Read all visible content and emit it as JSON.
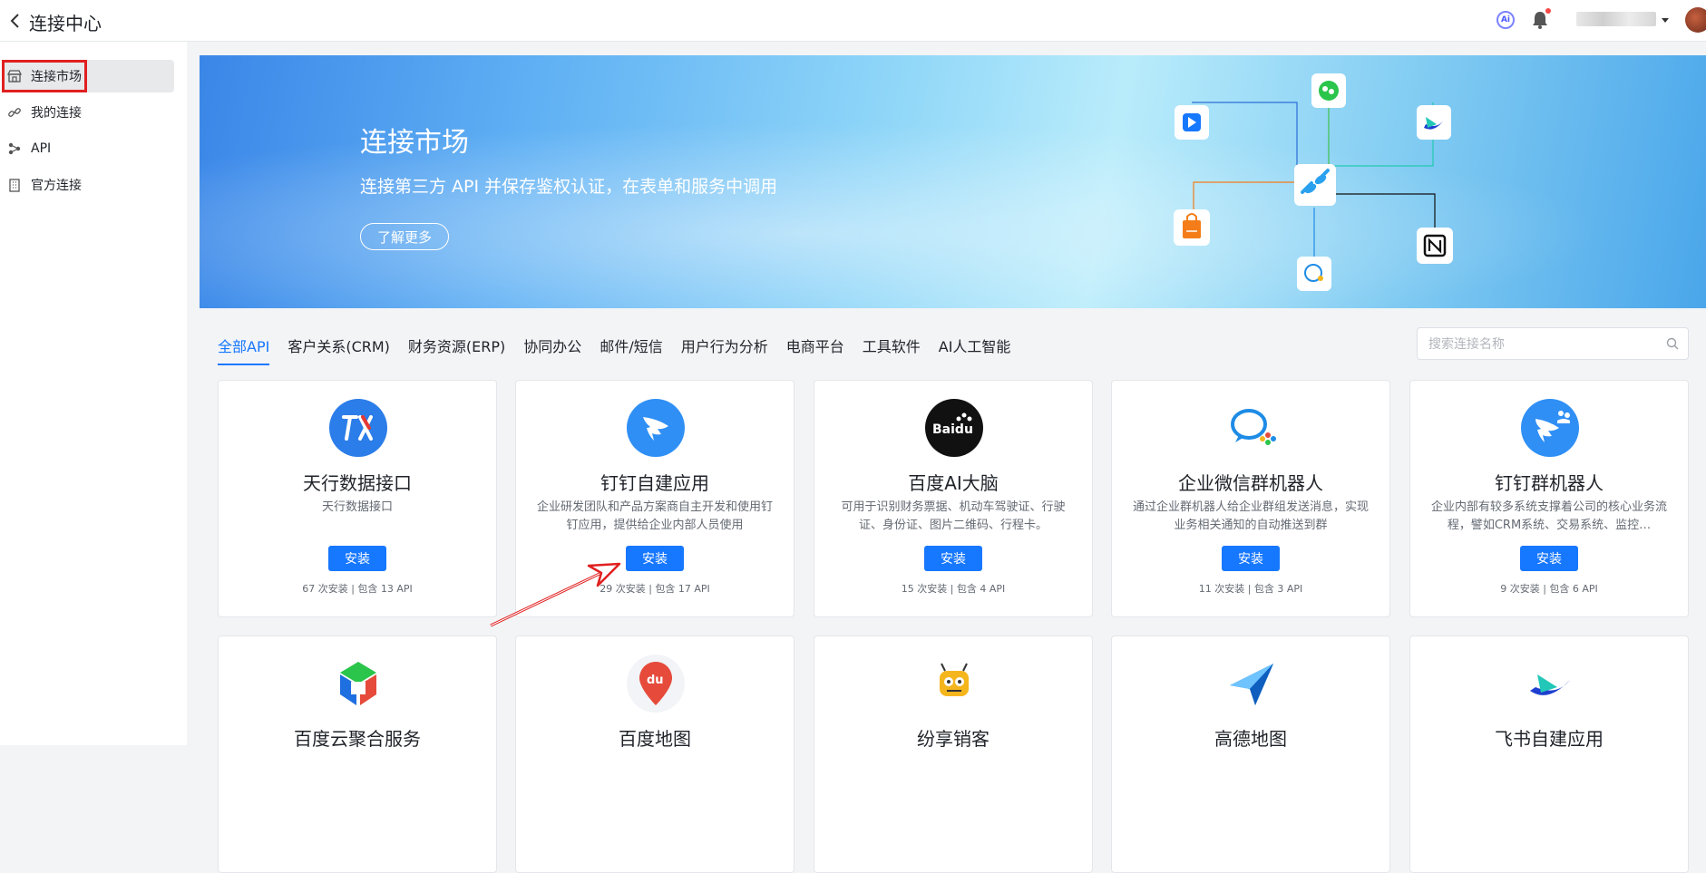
{
  "header": {
    "title": "连接中心",
    "ai_label": "Ai"
  },
  "sidebar": {
    "items": [
      {
        "label": "连接市场",
        "icon": "store-icon",
        "active": true
      },
      {
        "label": "我的连接",
        "icon": "link-icon",
        "active": false
      },
      {
        "label": "API",
        "icon": "api-nodes-icon",
        "active": false
      },
      {
        "label": "官方连接",
        "icon": "building-icon",
        "active": false
      }
    ]
  },
  "banner": {
    "title": "连接市场",
    "subtitle": "连接第三方 API 并保存鉴权认证，在表单和服务中调用",
    "button_label": "了解更多"
  },
  "tabs": [
    "全部API",
    "客户关系(CRM)",
    "财务资源(ERP)",
    "协同办公",
    "邮件/短信",
    "用户行为分析",
    "电商平台",
    "工具软件",
    "AI人工智能"
  ],
  "search": {
    "placeholder": "搜索连接名称"
  },
  "install_label": "安装",
  "cards": [
    {
      "title": "天行数据接口",
      "desc": "天行数据接口",
      "meta": "67 次安装 | 包含 13 API"
    },
    {
      "title": "钉钉自建应用",
      "desc": "企业研发团队和产品方案商自主开发和使用钉钉应用，提供给企业内部人员使用",
      "meta": "29 次安装 | 包含 17 API"
    },
    {
      "title": "百度AI大脑",
      "desc": "可用于识别财务票据、机动车驾驶证、行驶证、身份证、图片二维码、行程卡。",
      "meta": "15 次安装 | 包含 4 API"
    },
    {
      "title": "企业微信群机器人",
      "desc": "通过企业群机器人给企业群组发送消息，实现业务相关通知的自动推送到群",
      "meta": "11 次安装 | 包含 3 API"
    },
    {
      "title": "钉钉群机器人",
      "desc": "企业内部有较多系统支撑着公司的核心业务流程，譬如CRM系统、交易系统、监控…",
      "meta": "9 次安装 | 包含 6 API"
    },
    {
      "title": "百度云聚合服务"
    },
    {
      "title": "百度地图"
    },
    {
      "title": "纷享销客"
    },
    {
      "title": "高德地图"
    },
    {
      "title": "飞书自建应用"
    }
  ],
  "logo_texts": {
    "baidu_ai": "Baidu",
    "baidu_map": "du"
  },
  "colors": {
    "primary": "#1677ff",
    "highlight": "#e02020"
  }
}
